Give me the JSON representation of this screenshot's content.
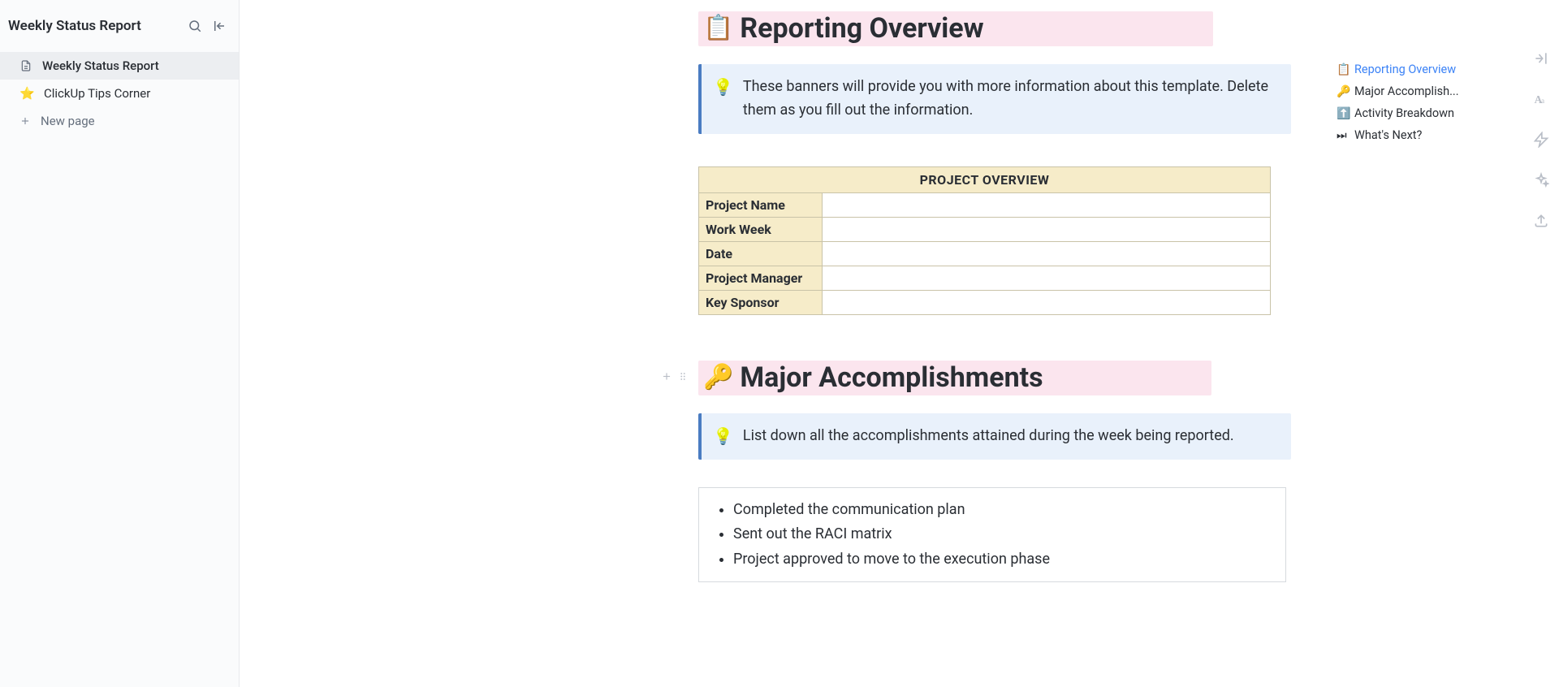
{
  "sidebar": {
    "title": "Weekly Status Report",
    "items": [
      {
        "icon_type": "page",
        "label": "Weekly Status Report",
        "active": true
      },
      {
        "icon_type": "emoji",
        "emoji": "⭐",
        "label": "ClickUp Tips Corner",
        "active": false
      }
    ],
    "new_page_label": "New page"
  },
  "doc": {
    "sections": [
      {
        "emoji": "📋",
        "heading": "Reporting Overview",
        "banner_emoji": "💡",
        "banner_text": "These banners will provide you with more information about this template. Delete them as you fill out the information.",
        "table": {
          "header": "PROJECT OVERVIEW",
          "rows": [
            {
              "label": "Project Name",
              "value": ""
            },
            {
              "label": "Work Week",
              "value": ""
            },
            {
              "label": "Date",
              "value": ""
            },
            {
              "label": "Project Manager",
              "value": ""
            },
            {
              "label": "Key Sponsor",
              "value": ""
            }
          ]
        }
      },
      {
        "emoji": "🔑",
        "heading": "Major Accomplishments",
        "banner_emoji": "💡",
        "banner_text": "List down all the accomplishments attained during the week being reported.",
        "bullets": [
          "Completed the communication plan",
          "Sent out the RACI matrix",
          "Project approved to move to the execution phase"
        ]
      }
    ]
  },
  "outline": [
    {
      "emoji": "📋",
      "label": "Reporting Overview",
      "active": true
    },
    {
      "emoji": "🔑",
      "label": "Major Accomplish...",
      "active": false
    },
    {
      "emoji": "⬆️",
      "label": "Activity Breakdown",
      "active": false
    },
    {
      "emoji": "⏭",
      "label": "What's Next?",
      "active": false
    }
  ]
}
